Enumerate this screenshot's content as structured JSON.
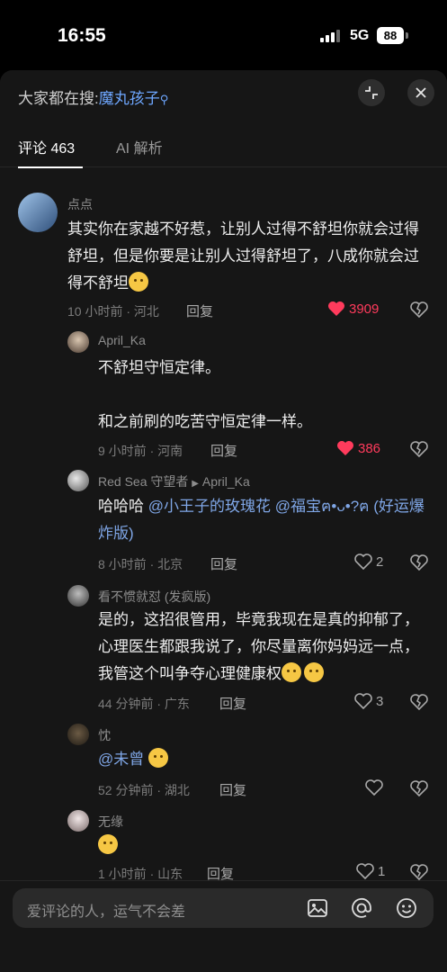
{
  "status_bar": {
    "time": "16:55",
    "network": "5G",
    "battery": "88"
  },
  "header": {
    "prefix": "大家都在搜:",
    "keyword": "魔丸孩子",
    "tabs": [
      {
        "label": "评论 463",
        "active": true
      },
      {
        "label": "AI 解析",
        "active": false
      }
    ]
  },
  "comments": [
    {
      "user": "点点",
      "text": "其实你在家越不好惹，让别人过得不舒坦你就会过得舒坦，但是你要是让别人过得舒坦了，八成你就会过得不舒坦",
      "meta": "10 小时前 · 河北",
      "reply": "回复",
      "likes": "3909",
      "liked": true
    },
    {
      "user": "April_Ka",
      "text_line1": "不舒坦守恒定律。",
      "text_line2": "和之前刷的吃苦守恒定律一样。",
      "meta": "9 小时前 · 河南",
      "reply": "回复",
      "likes": "386",
      "liked": true
    },
    {
      "user": "Red Sea 守望者",
      "reply_to": "April_Ka",
      "text_prefix": "哈哈哈 ",
      "mention1": "@小王子的玫瑰花",
      "mention2": "@福宝ฅ•ᴗ•?ฅ (好运爆炸版)",
      "meta": "8 小时前 · 北京",
      "reply": "回复",
      "likes": "2",
      "liked": false
    },
    {
      "user": "看不惯就怼 (发疯版)",
      "text": "是的，这招很管用，毕竟我现在是真的抑郁了，心理医生都跟我说了，你尽量离你妈妈远一点，我管这个叫争夺心理健康权",
      "meta": "44 分钟前 · 广东",
      "reply": "回复",
      "likes": "3",
      "liked": false
    },
    {
      "user": "忱",
      "mention": "@未曾",
      "meta": "52 分钟前 · 湖北",
      "reply": "回复",
      "likes": "",
      "liked": false
    },
    {
      "user": "无缘",
      "meta": "1 小时前 · 山东",
      "reply": "回复",
      "likes": "1",
      "liked": false
    }
  ],
  "input": {
    "placeholder": "爱评论的人，运气不会差"
  },
  "icons": [
    "signal-icon",
    "battery-icon",
    "search-icon",
    "collapse-icon",
    "close-icon",
    "heart-icon",
    "broken-heart-icon",
    "image-icon",
    "at-icon",
    "emoji-icon"
  ],
  "colors": {
    "accent_link": "#6ea7ff",
    "like_red": "#ff3b5c",
    "background": "#161616"
  }
}
